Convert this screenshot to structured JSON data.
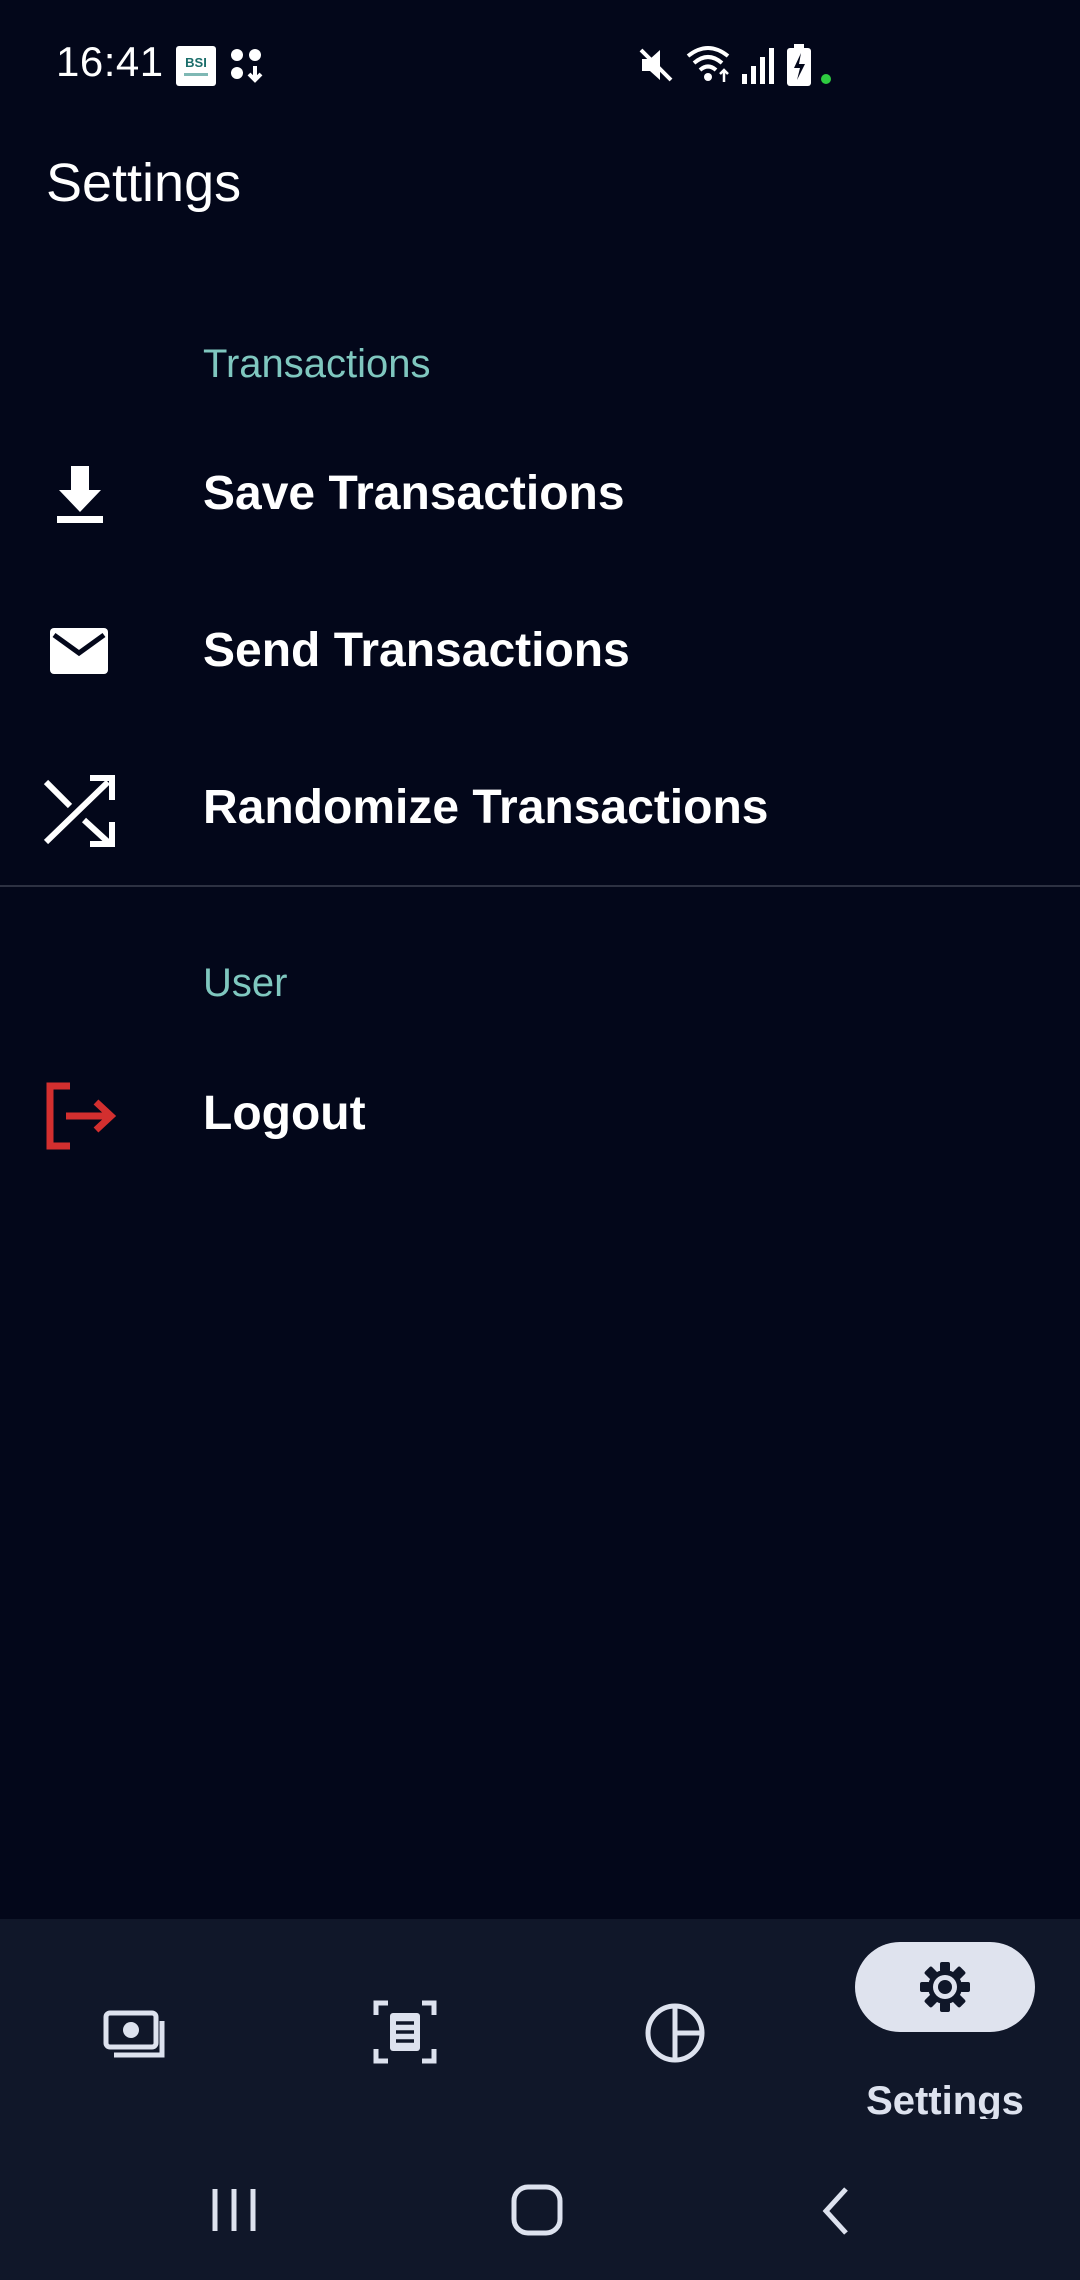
{
  "status_bar": {
    "time": "16:41",
    "notification_icons": [
      "bsi-app-icon",
      "apps-download-icon"
    ],
    "system_icons": [
      "mute-icon",
      "wifi-icon",
      "signal-icon",
      "battery-charging-icon"
    ],
    "indicator_color": "#2ecc40"
  },
  "app_bar": {
    "title": "Settings"
  },
  "sections": [
    {
      "header": "Transactions",
      "items": [
        {
          "label": "Save Transactions",
          "icon": "download-icon"
        },
        {
          "label": "Send Transactions",
          "icon": "mail-icon"
        },
        {
          "label": "Randomize Transactions",
          "icon": "shuffle-icon"
        }
      ]
    },
    {
      "header": "User",
      "items": [
        {
          "label": "Logout",
          "icon": "logout-icon",
          "color": "#d32f2f"
        }
      ]
    }
  ],
  "bottom_nav": {
    "items": [
      {
        "icon": "money-icon"
      },
      {
        "icon": "scan-receipt-icon"
      },
      {
        "icon": "pie-chart-icon"
      },
      {
        "icon": "gear-icon",
        "label": "Settings",
        "selected": true
      }
    ]
  },
  "system_nav": {
    "buttons": [
      "recents-icon",
      "home-icon",
      "back-icon"
    ]
  },
  "colors": {
    "background": "#03071a",
    "accent_header": "#7fc7bf",
    "nav_background": "#101729",
    "selected_pill": "#dfe3ee",
    "logout_red": "#d32f2f"
  }
}
